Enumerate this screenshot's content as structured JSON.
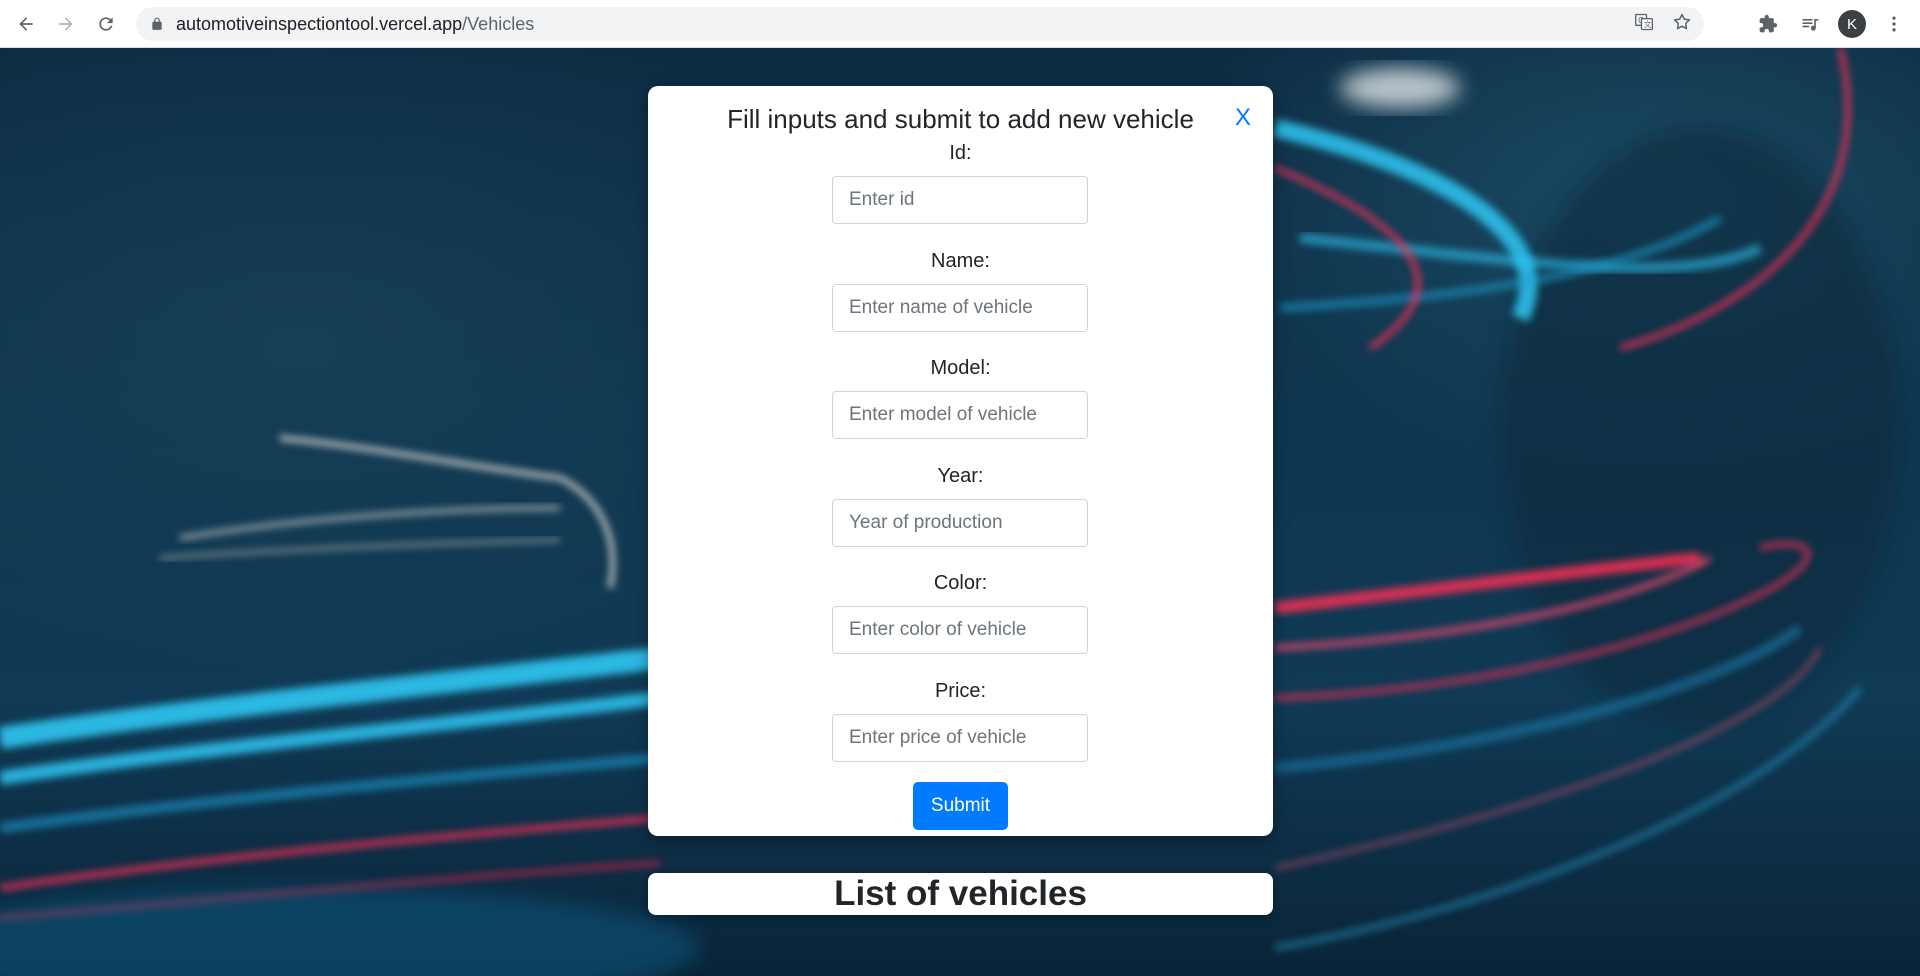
{
  "browser": {
    "url_host": "automotiveinspectiontool.vercel.app",
    "url_path": "/Vehicles",
    "avatar_letter": "K"
  },
  "modal": {
    "title": "Fill inputs and submit to add new vehicle",
    "close_label": "X",
    "fields": [
      {
        "label": "Id:",
        "placeholder": "Enter id",
        "value": ""
      },
      {
        "label": "Name:",
        "placeholder": "Enter name of vehicle",
        "value": ""
      },
      {
        "label": "Model:",
        "placeholder": "Enter model of vehicle",
        "value": ""
      },
      {
        "label": "Year:",
        "placeholder": "Year of production",
        "value": ""
      },
      {
        "label": "Color:",
        "placeholder": "Enter color of vehicle",
        "value": ""
      },
      {
        "label": "Price:",
        "placeholder": "Enter price of vehicle",
        "value": ""
      }
    ],
    "submit_label": "Submit"
  },
  "list": {
    "title": "List of vehicles"
  },
  "colors": {
    "accent": "#007bff",
    "light_trail_blue": "#2ec6f2",
    "light_trail_red": "#ff2d55"
  }
}
